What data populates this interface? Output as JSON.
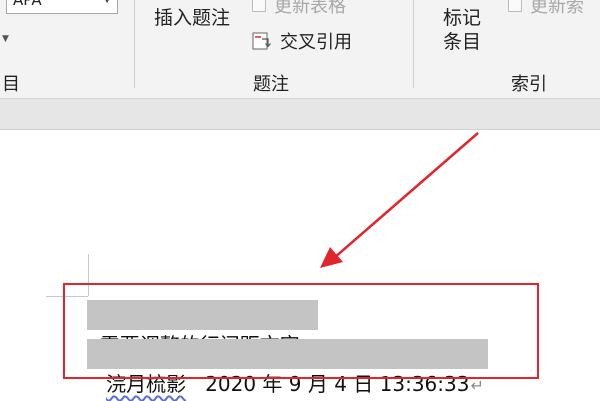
{
  "ribbon": {
    "style_select_value": "APA",
    "left_group_label": "目",
    "caption_group": {
      "insert_caption_label": "插入题注",
      "update_table_label": "更新表格",
      "cross_reference_label": "交叉引用",
      "group_label": "题注"
    },
    "index_group": {
      "mark_entry_line1": "标记",
      "mark_entry_line2": "条目",
      "update_index_label": "更新索",
      "group_label": "索引"
    }
  },
  "document": {
    "line1_text": "需要调整的行间距文字",
    "line2_name": "浣月梳影",
    "line2_date": "2020 年 9 月 4 日 13:36:33",
    "paragraph_mark": "↵"
  },
  "colors": {
    "annotation_red": "#e0252d",
    "selection_gray": "#c4c4c4",
    "ribbon_bg": "#f3f3f3"
  }
}
